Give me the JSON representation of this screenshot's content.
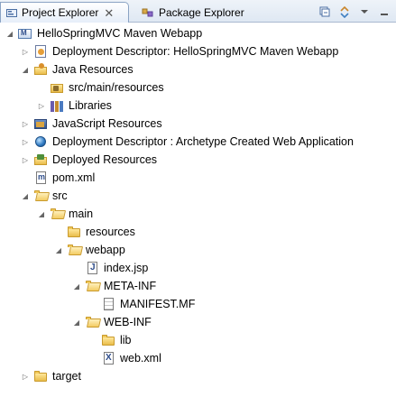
{
  "tabs": [
    {
      "label": "Project Explorer",
      "active": true,
      "icon": "project-explorer-icon",
      "close": "✕"
    },
    {
      "label": "Package Explorer",
      "active": false,
      "icon": "package-explorer-icon"
    }
  ],
  "toolbar": {
    "items": [
      "collapse-all-icon",
      "link-with-editor-icon",
      "view-menu-icon",
      "minimize-icon"
    ]
  },
  "tree": {
    "root": {
      "label": "HelloSpringMVC Maven Webapp",
      "icon": "project-icon",
      "expanded": true
    },
    "items": [
      {
        "label": "Deployment Descriptor: HelloSpringMVC Maven Webapp",
        "icon": "deployment-descriptor-icon",
        "twisty": "collapsed"
      },
      {
        "label": "Java Resources",
        "icon": "java-resources-icon",
        "twisty": "expanded"
      },
      {
        "label": "src/main/resources",
        "icon": "source-folder-icon",
        "twisty": "none"
      },
      {
        "label": "Libraries",
        "icon": "libraries-icon",
        "twisty": "collapsed"
      },
      {
        "label": "JavaScript Resources",
        "icon": "javascript-resources-icon",
        "twisty": "collapsed"
      },
      {
        "label": "Deployment Descriptor : Archetype Created Web Application",
        "icon": "web-globe-icon",
        "twisty": "collapsed"
      },
      {
        "label": "Deployed Resources",
        "icon": "deployed-resources-icon",
        "twisty": "collapsed"
      },
      {
        "label": "pom.xml",
        "icon": "maven-pom-icon",
        "twisty": "none"
      },
      {
        "label": "src",
        "icon": "folder-open-icon",
        "twisty": "expanded"
      },
      {
        "label": "main",
        "icon": "folder-open-icon",
        "twisty": "expanded"
      },
      {
        "label": "resources",
        "icon": "folder-icon",
        "twisty": "none"
      },
      {
        "label": "webapp",
        "icon": "folder-open-icon",
        "twisty": "expanded"
      },
      {
        "label": "index.jsp",
        "icon": "jsp-file-icon",
        "twisty": "none"
      },
      {
        "label": "META-INF",
        "icon": "folder-open-icon",
        "twisty": "expanded"
      },
      {
        "label": "MANIFEST.MF",
        "icon": "text-file-icon",
        "twisty": "none"
      },
      {
        "label": "WEB-INF",
        "icon": "folder-open-icon",
        "twisty": "expanded"
      },
      {
        "label": "lib",
        "icon": "folder-icon",
        "twisty": "none"
      },
      {
        "label": "web.xml",
        "icon": "xml-file-icon",
        "twisty": "none"
      },
      {
        "label": "target",
        "icon": "folder-icon",
        "twisty": "collapsed"
      }
    ]
  }
}
